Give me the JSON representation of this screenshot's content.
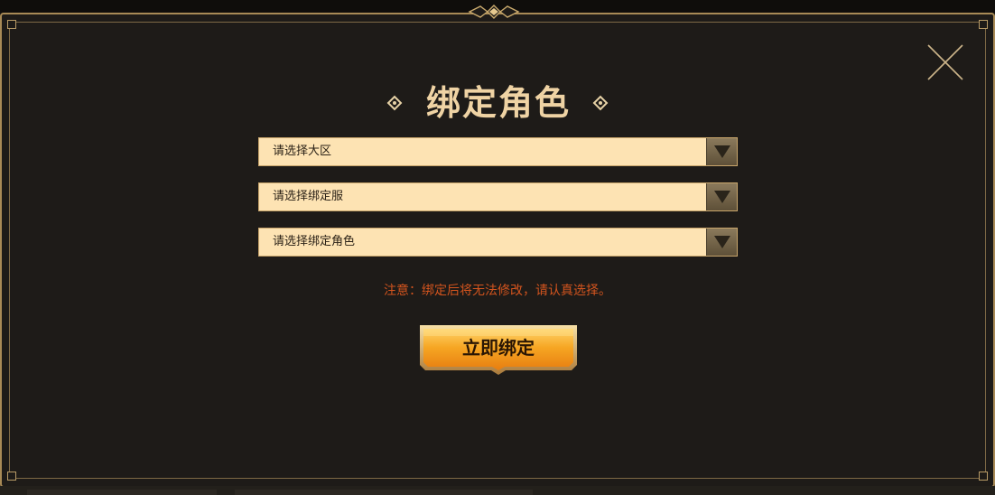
{
  "dialog": {
    "title": "绑定角色",
    "close_icon": "close-icon",
    "selects": [
      {
        "placeholder": "请选择大区",
        "icon": "chevron-down-icon"
      },
      {
        "placeholder": "请选择绑定服",
        "icon": "chevron-down-icon"
      },
      {
        "placeholder": "请选择绑定角色",
        "icon": "chevron-down-icon"
      }
    ],
    "notice": "注意：绑定后将无法修改，请认真选择。",
    "bind_button_label": "立即绑定"
  },
  "colors": {
    "frame_gold": "#a88a56",
    "title": "#efd3a4",
    "select_bg": "#fde3b3",
    "notice": "#d2541e",
    "button_gold": "#f29b1e"
  }
}
